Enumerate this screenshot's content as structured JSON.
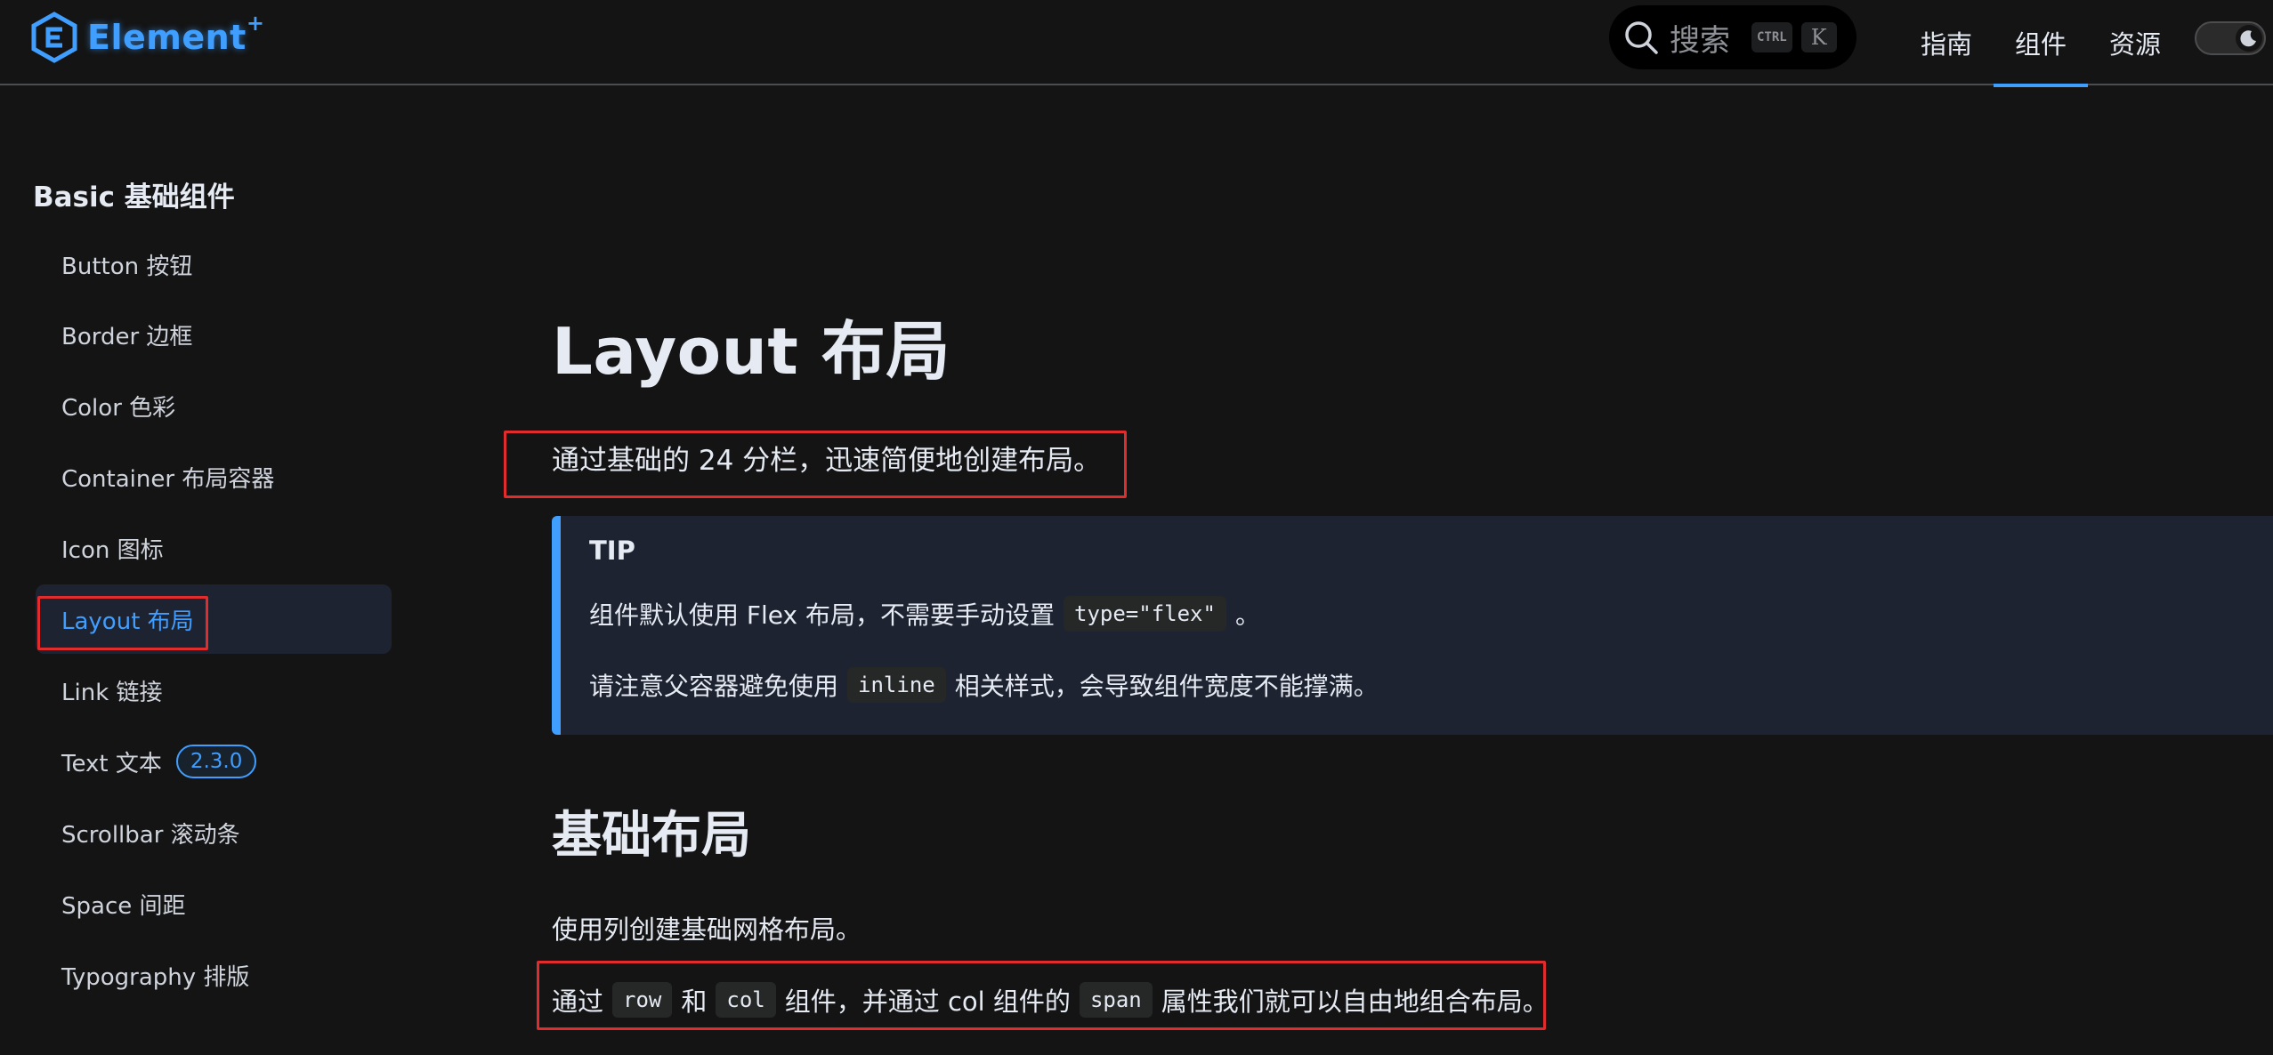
{
  "colors": {
    "accent": "#409eff",
    "background": "#141414",
    "annotation": "#e02c2c"
  },
  "header": {
    "logo_text": "Element",
    "logo_plus": "+",
    "search": {
      "placeholder": "搜索",
      "kbd_ctrl": "CTRL",
      "kbd_key": "K"
    },
    "nav": [
      {
        "label": "指南",
        "active": false
      },
      {
        "label": "组件",
        "active": true
      },
      {
        "label": "资源",
        "active": false
      }
    ],
    "theme_toggle_icon": "moon-icon"
  },
  "sidebar": {
    "group_title": "Basic 基础组件",
    "items": [
      {
        "label": "Button 按钮"
      },
      {
        "label": "Border 边框"
      },
      {
        "label": "Color 色彩"
      },
      {
        "label": "Container 布局容器"
      },
      {
        "label": "Icon 图标"
      },
      {
        "label": "Layout 布局",
        "active": true
      },
      {
        "label": "Link 链接"
      },
      {
        "label": "Text 文本",
        "badge": "2.3.0"
      },
      {
        "label": "Scrollbar 滚动条"
      },
      {
        "label": "Space 间距"
      },
      {
        "label": "Typography 排版"
      }
    ]
  },
  "main": {
    "title": "Layout 布局",
    "lead": "通过基础的 24 分栏，迅速简便地创建布局。",
    "tip": {
      "title": "TIP",
      "line1": {
        "before": "组件默认使用 Flex 布局，不需要手动设置",
        "code": "type=\"flex\"",
        "after": "。"
      },
      "line2": {
        "before": "请注意父容器避免使用",
        "code": "inline",
        "after": "相关样式，会导致组件宽度不能撑满。"
      }
    },
    "section_title": "基础布局",
    "para1": "使用列创建基础网格布局。",
    "para2": {
      "t1": "通过",
      "c1": "row",
      "t2": "和",
      "c2": "col",
      "t3": "组件，并通过 col 组件的",
      "c3": "span",
      "t4": "属性我们就可以自由地组合布局。"
    }
  }
}
